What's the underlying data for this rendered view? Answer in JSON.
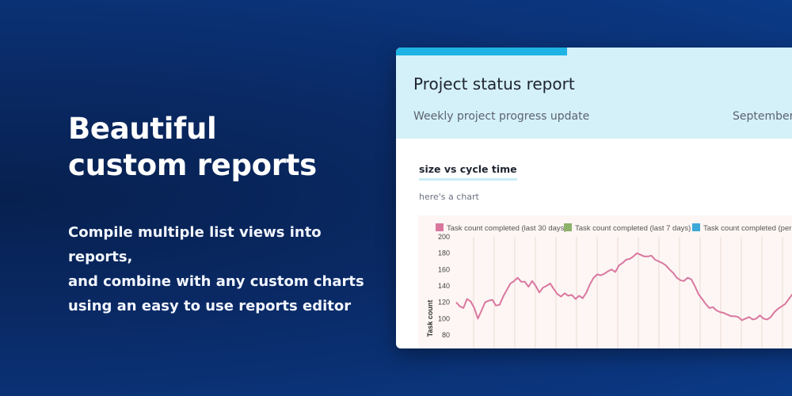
{
  "hero": {
    "headline_line1": "Beautiful",
    "headline_line2": "custom reports",
    "body_line1": "Compile multiple list views into reports,",
    "body_line2": "and combine with any custom charts",
    "body_line3": "using an easy to use reports editor"
  },
  "report": {
    "title": "Project status report",
    "subtitle": "Weekly project progress update",
    "date": "September",
    "section_title": "size vs cycle time",
    "section_desc": "here's a chart"
  },
  "colors": {
    "accent": "#1fb3e5",
    "header_bg": "#d4f0f8",
    "series_30": "#d9779f",
    "series_7": "#8db36a",
    "series_per": "#3ca9d8"
  },
  "chart_data": {
    "type": "line",
    "title": "",
    "xlabel": "",
    "ylabel": "Task count",
    "ylim": [
      80,
      200
    ],
    "yticks": [
      200,
      180,
      160,
      140,
      120,
      100,
      80
    ],
    "grid": true,
    "legend_position": "top",
    "series": [
      {
        "name": "Task count completed (last 30 days)",
        "color": "#d9779f",
        "values": [
          120,
          115,
          113,
          124,
          121,
          113,
          100,
          110,
          120,
          122,
          123,
          116,
          117,
          127,
          135,
          143,
          146,
          150,
          145,
          145,
          139,
          146,
          140,
          132,
          138,
          140,
          143,
          136,
          130,
          127,
          131,
          128,
          129,
          124,
          128,
          125,
          132,
          142,
          150,
          154,
          153,
          155,
          158,
          160,
          157,
          165,
          168,
          172,
          173,
          176,
          180,
          178,
          176,
          176,
          177,
          172,
          170,
          168,
          165,
          160,
          156,
          150,
          147,
          146,
          150,
          148,
          140,
          130,
          124,
          118,
          113,
          114,
          110,
          108,
          107,
          105,
          103,
          103,
          102,
          98,
          100,
          102,
          99,
          100,
          104,
          100,
          99,
          102,
          108,
          112,
          115,
          118,
          124,
          130,
          133,
          128,
          132,
          134,
          136,
          133
        ]
      },
      {
        "name": "Task count completed (last 7 days)",
        "color": "#8db36a",
        "values": []
      },
      {
        "name": "Task count completed (per",
        "color": "#3ca9d8",
        "values": []
      }
    ]
  }
}
